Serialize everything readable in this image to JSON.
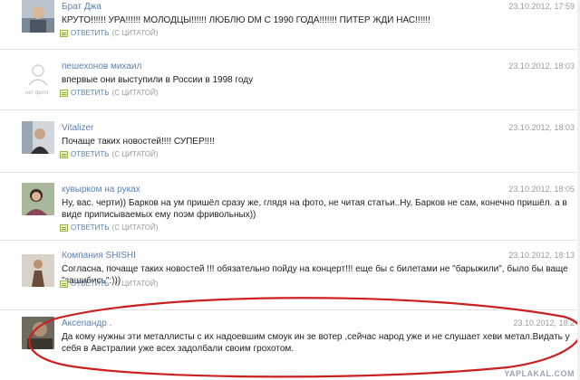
{
  "comments": [
    {
      "author": "Брат Джа",
      "date": "23.10.2012, 17:59",
      "text": "КРУТО!!!!!! УРА!!!!!! МОЛОДЦЫ!!!!!! ЛЮБЛЮ DM С 1990 ГОДА!!!!!!! ПИТЕР ЖДИ НАС!!!!!!",
      "avatar": "photo"
    },
    {
      "author": "пешехонов михаил",
      "date": "23.10.2012, 18:03",
      "text": "впервые они выступили в России в 1998 году",
      "avatar": "no-photo",
      "avatar_caption": "нет фото"
    },
    {
      "author": "Vitalizer",
      "date": "23.10.2012, 18:03",
      "text": "Почаще таких новостей!!!! СУПЕР!!!!",
      "avatar": "photo"
    },
    {
      "author": "кувырком на руках",
      "date": "23.10.2012, 18:05",
      "text": "Ну, вас. черти)) Барков на ум пришёл сразу же, глядя на фото, не читая статьи..Ну, Барков не сам, конечно пришёл. а в виде приписываемых ему поэм фривольных))",
      "avatar": "photo"
    },
    {
      "author": "Компания SHISHI",
      "date": "23.10.2012, 18:13",
      "text": "Согласна, почаще таких новостей !!! обязательно пойду на концерт!!! еще бы с билетами не \"барыжили\", было бы ваще \"зашибись\":)))",
      "avatar": "photo"
    },
    {
      "author": "Аксеnандр .",
      "date": "23.10.2012, 18:2",
      "text": "Да кому нужны эти металлисты с их надоевшим смоук ин зе вотер ,сейчас народ уже и не слушает хеви метал.Видать у себя в Австралии уже всех задолбали своим грохотом.",
      "avatar": "photo"
    }
  ],
  "actions": {
    "reply": "ОТВЕТИТЬ",
    "quote": "(С ЦИТАТОЙ)"
  },
  "watermark": "YAPLAKAL.COM",
  "colors": {
    "author": "#5a82b0",
    "date": "#9b9b9b",
    "annotation_ellipse": "#cc1f1f"
  }
}
